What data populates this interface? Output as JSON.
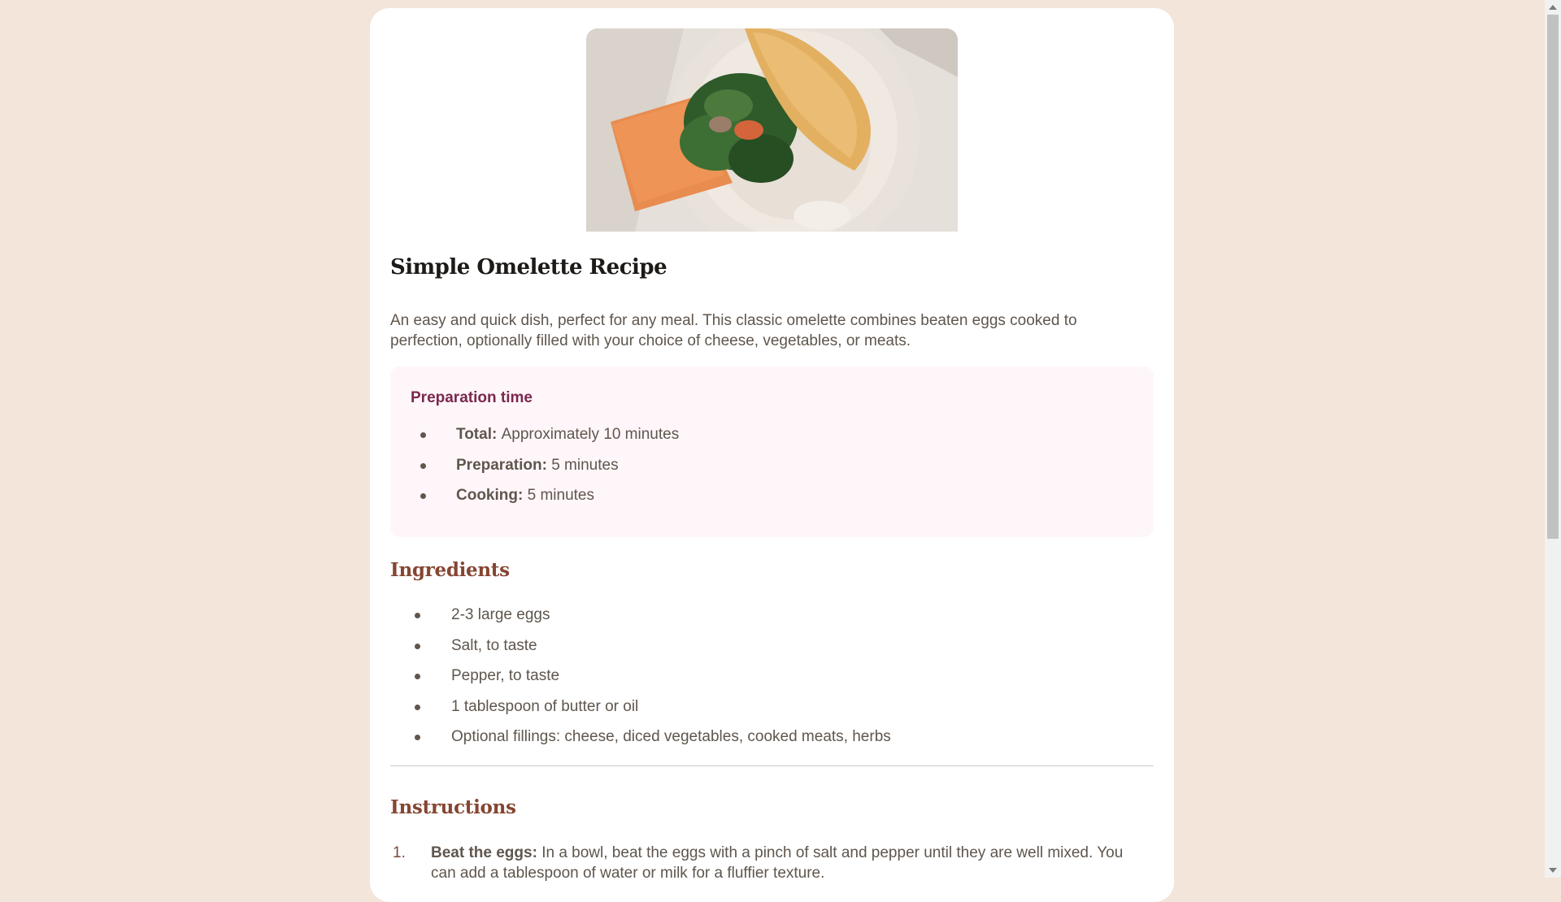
{
  "recipe": {
    "image_alt": "Omelette with spinach and vegetables on a plate",
    "title": "Simple Omelette Recipe",
    "intro": "An easy and quick dish, perfect for any meal. This classic omelette combines beaten eggs cooked to perfection, optionally filled with your choice of cheese, vegetables, or meats."
  },
  "prep": {
    "heading": "Preparation time",
    "items": [
      {
        "label": "Total:",
        "value": "Approximately 10 minutes"
      },
      {
        "label": "Preparation:",
        "value": "5 minutes"
      },
      {
        "label": "Cooking:",
        "value": "5 minutes"
      }
    ]
  },
  "ingredients": {
    "heading": "Ingredients",
    "items": [
      "2-3 large eggs",
      "Salt, to taste",
      "Pepper, to taste",
      "1 tablespoon of butter or oil",
      "Optional fillings: cheese, diced vegetables, cooked meats, herbs"
    ]
  },
  "instructions": {
    "heading": "Instructions",
    "items": [
      {
        "num": "1.",
        "label": "Beat the eggs:",
        "text": "In a bowl, beat the eggs with a pinch of salt and pepper until they are well mixed. You can add a tablespoon of water or milk for a fluffier texture."
      }
    ]
  },
  "colors": {
    "page_bg": "#f3e5da",
    "card_bg": "#ffffff",
    "prep_bg": "#fff6fa",
    "prep_heading": "#7a284e",
    "section_heading": "#854632",
    "body_text": "#5f564d"
  }
}
